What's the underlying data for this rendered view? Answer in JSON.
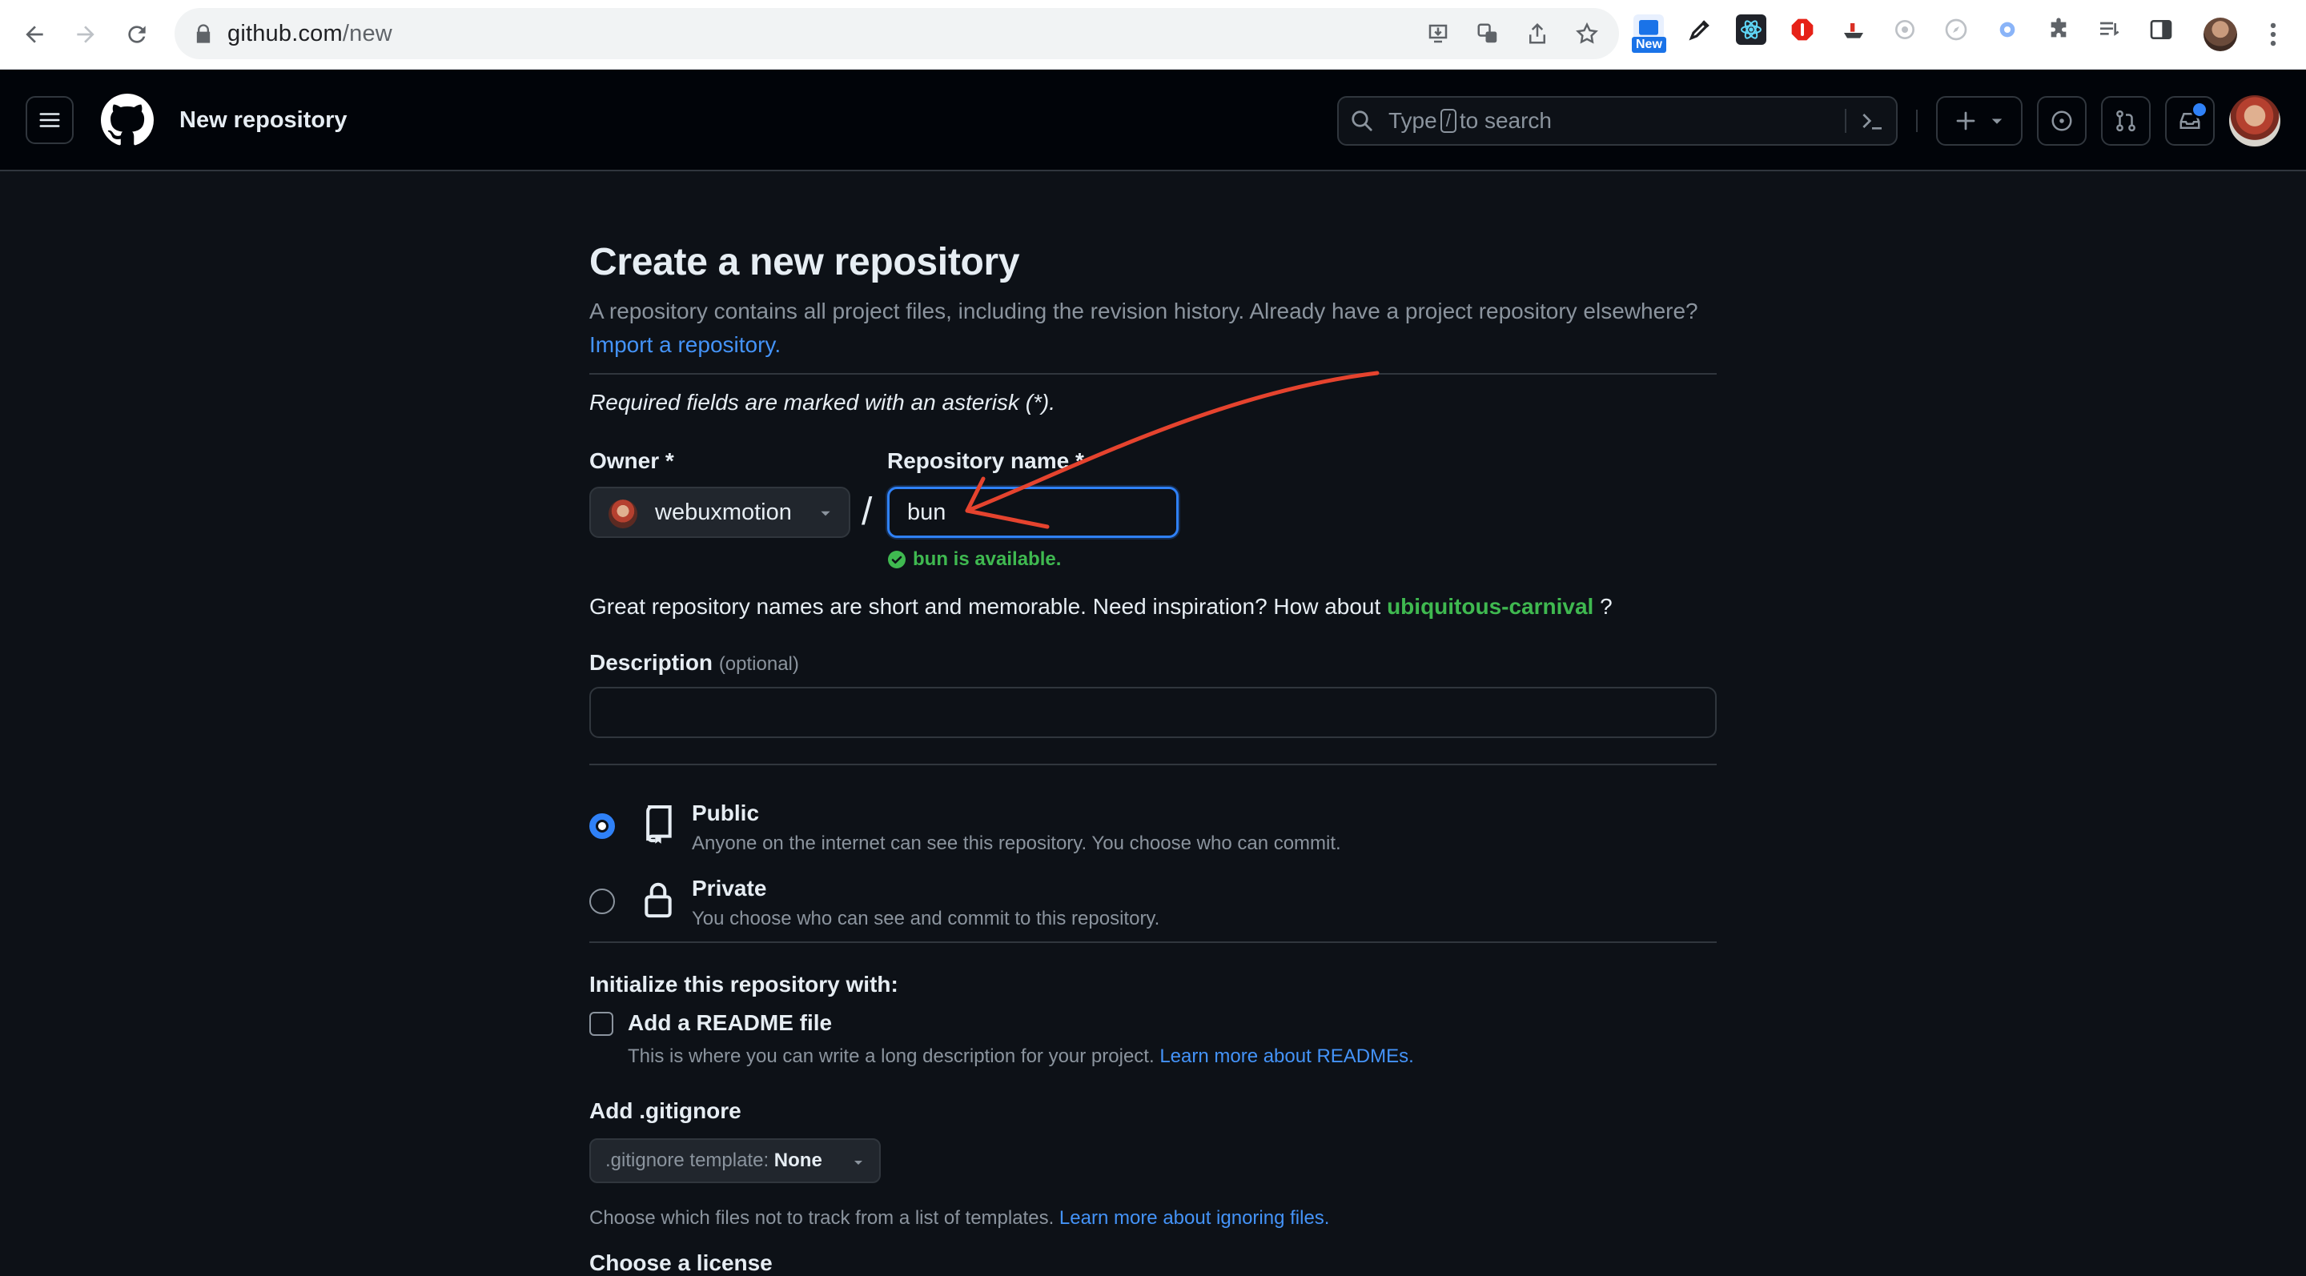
{
  "browser": {
    "url_host": "github.com",
    "url_path": "/new",
    "extension_badge": "New"
  },
  "header": {
    "title": "New repository",
    "search_placeholder_pre": "Type",
    "search_key": "/",
    "search_placeholder_post": "to search"
  },
  "form": {
    "title": "Create a new repository",
    "description": "A repository contains all project files, including the revision history. Already have a project repository elsewhere?",
    "import_link": "Import a repository.",
    "required_note": "Required fields are marked with an asterisk (*).",
    "owner_label": "Owner *",
    "owner_value": "webuxmotion",
    "slash": "/",
    "repo_name_label": "Repository name *",
    "repo_name_value": "bun",
    "availability": "bun is available.",
    "suggest_pre": "Great repository names are short and memorable. Need inspiration? How about",
    "suggest_name": "ubiquitous-carnival",
    "suggest_post": "?",
    "description_label": "Description",
    "description_optional": "(optional)",
    "description_value": "",
    "visibility": [
      {
        "title": "Public",
        "subtitle": "Anyone on the internet can see this repository. You choose who can commit.",
        "checked": true
      },
      {
        "title": "Private",
        "subtitle": "You choose who can see and commit to this repository.",
        "checked": false
      }
    ],
    "init_title": "Initialize this repository with:",
    "readme_label": "Add a README file",
    "readme_sub": "This is where you can write a long description for your project.",
    "readme_link": "Learn more about READMEs.",
    "gitignore_title": "Add .gitignore",
    "gitignore_select_label": ".gitignore template:",
    "gitignore_select_value": "None",
    "gitignore_help": "Choose which files not to track from a list of templates.",
    "gitignore_link": "Learn more about ignoring files.",
    "license_title": "Choose a license"
  },
  "colors": {
    "accent": "#2f81f7",
    "link": "#4493f8",
    "success": "#3fb950",
    "annotation": "#e5432e",
    "background": "#0d1117"
  }
}
